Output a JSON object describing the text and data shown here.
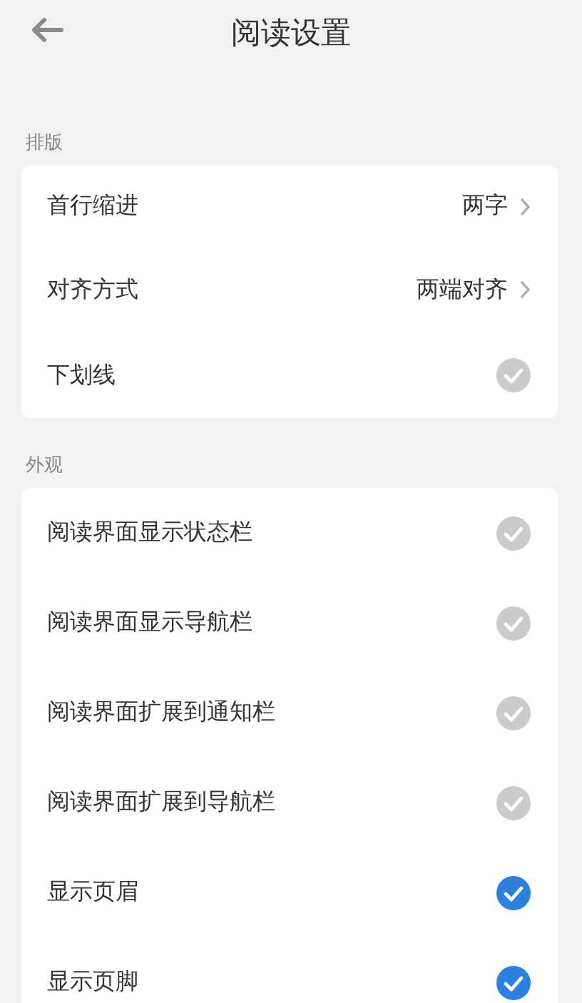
{
  "header": {
    "title": "阅读设置"
  },
  "sections": [
    {
      "label": "排版",
      "rows": [
        {
          "kind": "value",
          "label": "首行缩进",
          "value": "两字"
        },
        {
          "kind": "value",
          "label": "对齐方式",
          "value": "两端对齐"
        },
        {
          "kind": "check",
          "label": "下划线",
          "checked": false
        }
      ]
    },
    {
      "label": "外观",
      "rows": [
        {
          "kind": "check",
          "label": "阅读界面显示状态栏",
          "checked": false
        },
        {
          "kind": "check",
          "label": "阅读界面显示导航栏",
          "checked": false
        },
        {
          "kind": "check",
          "label": "阅读界面扩展到通知栏",
          "checked": false
        },
        {
          "kind": "check",
          "label": "阅读界面扩展到导航栏",
          "checked": false
        },
        {
          "kind": "check",
          "label": "显示页眉",
          "checked": true
        },
        {
          "kind": "check",
          "label": "显示页脚",
          "checked": true
        }
      ]
    }
  ]
}
